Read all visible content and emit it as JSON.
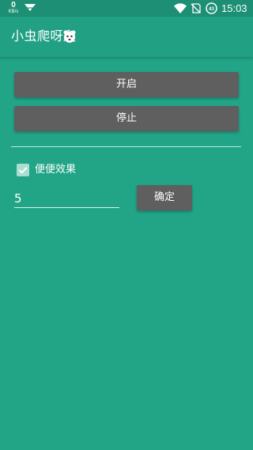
{
  "status_bar": {
    "net_speed_value": "0",
    "net_speed_unit": "KB/s",
    "battery_level": "43",
    "time": "15:03"
  },
  "app_bar": {
    "title": "小虫爬呀爬"
  },
  "buttons": {
    "start_label": "开启",
    "stop_label": "停止",
    "confirm_label": "确定"
  },
  "options": {
    "checkbox_label": "便便效果",
    "checkbox_checked": true,
    "input_value": "5"
  },
  "colors": {
    "background": "#22a587",
    "status_bar": "#1d8f74",
    "app_bar": "#21a083",
    "button": "#5f5f5f"
  },
  "icons": {
    "status_left": [
      "download-arrow-icon"
    ],
    "status_right": [
      "wifi-icon",
      "no-sim-icon",
      "battery-icon"
    ],
    "app_bar": [
      "app-logo-icon"
    ],
    "checkbox": "check-icon"
  }
}
